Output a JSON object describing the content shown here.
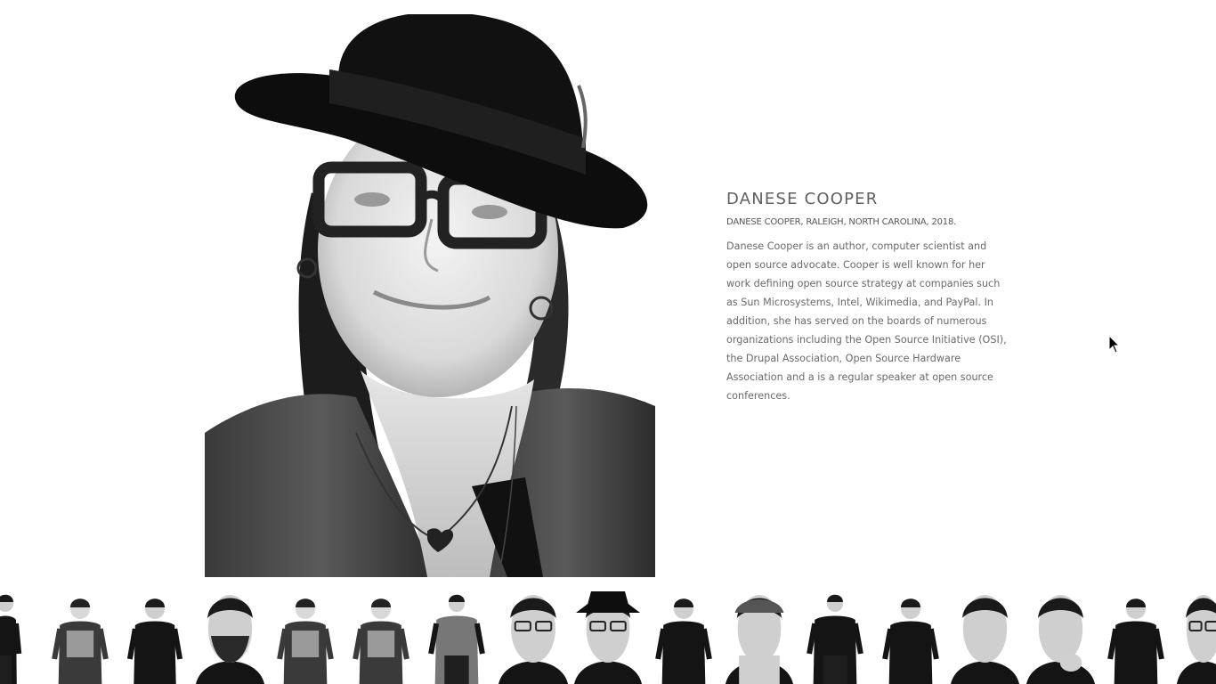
{
  "profile": {
    "name": "DANESE COOPER",
    "caption": "DANESE COOPER, RALEIGH, NORTH CAROLINA, 2018.",
    "bio": "Danese Cooper is an author, computer scientist and open source advocate. Cooper is well known for her work defining open source strategy at companies such as Sun Microsystems, Intel, Wikimedia, and PayPal. In addition, she has served on the boards of numerous organizations including the Open Source Initiative (OSI), the Drupal Association, Open Source Hardware Association and a is a regular speaker at open source conferences."
  },
  "thumbnails": [
    {
      "icon": "portrait-thumbnail",
      "style": "fullbody-dark"
    },
    {
      "icon": "portrait-thumbnail",
      "style": "halfbody-light"
    },
    {
      "icon": "portrait-thumbnail",
      "style": "suit-dark"
    },
    {
      "icon": "portrait-thumbnail",
      "style": "closeup-bearded"
    },
    {
      "icon": "portrait-thumbnail",
      "style": "halfbody-light"
    },
    {
      "icon": "portrait-thumbnail",
      "style": "halfbody-light"
    },
    {
      "icon": "portrait-thumbnail",
      "style": "fullbody-plaid"
    },
    {
      "icon": "portrait-thumbnail",
      "style": "closeup-glasses"
    },
    {
      "icon": "portrait-thumbnail",
      "style": "closeup-hat"
    },
    {
      "icon": "portrait-thumbnail",
      "style": "halfbody-dark"
    },
    {
      "icon": "portrait-thumbnail",
      "style": "closeup-cap"
    },
    {
      "icon": "portrait-thumbnail",
      "style": "fullbody-dark"
    },
    {
      "icon": "portrait-thumbnail",
      "style": "halfbody-dark"
    },
    {
      "icon": "portrait-thumbnail",
      "style": "closeup-dark"
    },
    {
      "icon": "portrait-thumbnail",
      "style": "closeup-hand"
    },
    {
      "icon": "portrait-thumbnail",
      "style": "halfbody-dark"
    },
    {
      "icon": "portrait-thumbnail",
      "style": "closeup-glasses"
    }
  ],
  "colors": {
    "background": "#ffffff",
    "name_text": "#606060",
    "body_text": "#6a6a6a"
  }
}
